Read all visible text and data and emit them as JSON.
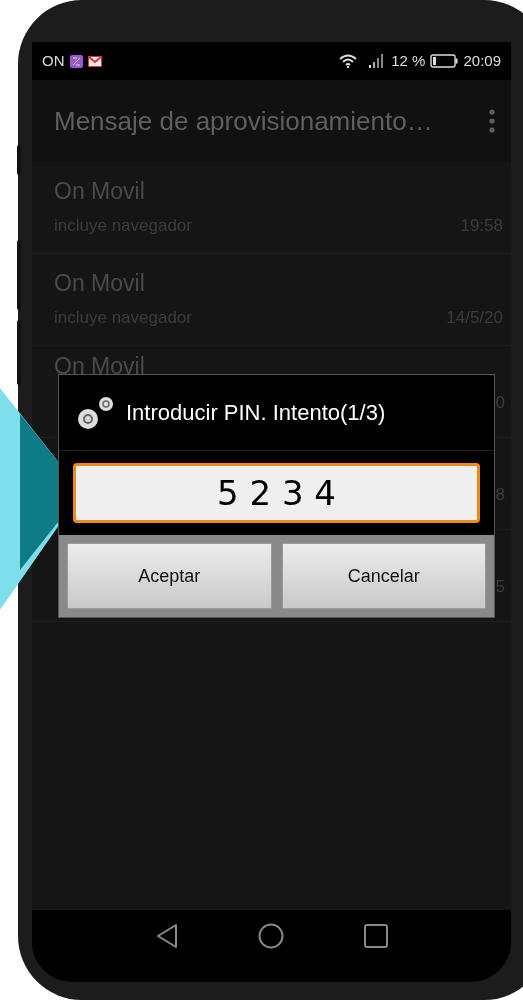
{
  "status_bar": {
    "carrier": "ON",
    "battery": "12 %",
    "time": "20:09"
  },
  "app_bar": {
    "title": "Mensaje de aprovisionamiento…"
  },
  "messages": [
    {
      "title": "On Movil",
      "subtitle": "incluye navegador",
      "date": "19:58"
    },
    {
      "title": "On Movil",
      "subtitle": "incluye navegador",
      "date": "14/5/20"
    },
    {
      "title": "On Movil",
      "date": "0"
    },
    {
      "date": "8"
    },
    {
      "date": "5"
    }
  ],
  "dialog": {
    "title": "Introducir PIN. Intento(1/3)",
    "pin": "5 2 3 4",
    "buttons": [
      "Aceptar",
      "Cancelar"
    ]
  }
}
